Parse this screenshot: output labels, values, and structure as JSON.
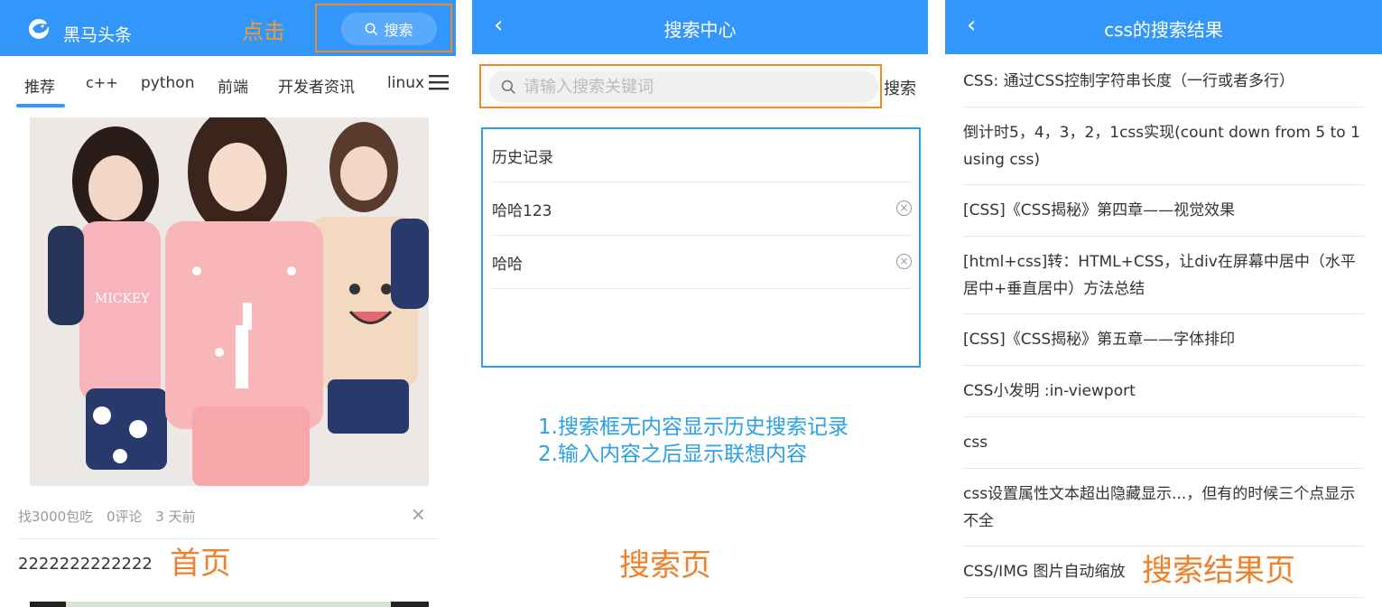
{
  "home": {
    "brand": "黑马头条",
    "click_note": "点击",
    "search_button": "搜索",
    "tabs": [
      "推荐",
      "c++",
      "python",
      "前端",
      "开发者资讯",
      "linux"
    ],
    "article": {
      "author": "找3000包吃",
      "comments": "0评论",
      "time": "3 天前"
    },
    "article2_title": "2222222222222",
    "page_label": "首页"
  },
  "search": {
    "title": "搜索中心",
    "placeholder": "请输入搜索关键词",
    "search_button": "搜索",
    "history_title": "历史记录",
    "history": [
      "哈哈123",
      "哈哈"
    ],
    "hint_line1": "1.搜索框无内容显示历史搜索记录",
    "hint_line2": "2.输入内容之后显示联想内容",
    "page_label": "搜索页"
  },
  "results": {
    "title": "css的搜索结果",
    "items": [
      "CSS: 通过CSS控制字符串长度（一行或者多行）",
      "倒计时5，4，3，2，1css实现(count down from 5 to 1 using css)",
      "[CSS]《CSS揭秘》第四章——视觉效果",
      "[html+css]转：HTML+CSS，让div在屏幕中居中（水平居中+垂直居中）方法总结",
      "[CSS]《CSS揭秘》第五章——字体排印",
      "CSS小发明 :in-viewport",
      "css",
      "css设置属性文本超出隐藏显示...，但有的时候三个点显示不全",
      "CSS/IMG 图片自动缩放"
    ],
    "page_label": "搜索结果页"
  },
  "colors": {
    "primary": "#3296fa",
    "annotation_orange": "#f0802a",
    "annotation_blue": "#2aa0e6"
  }
}
